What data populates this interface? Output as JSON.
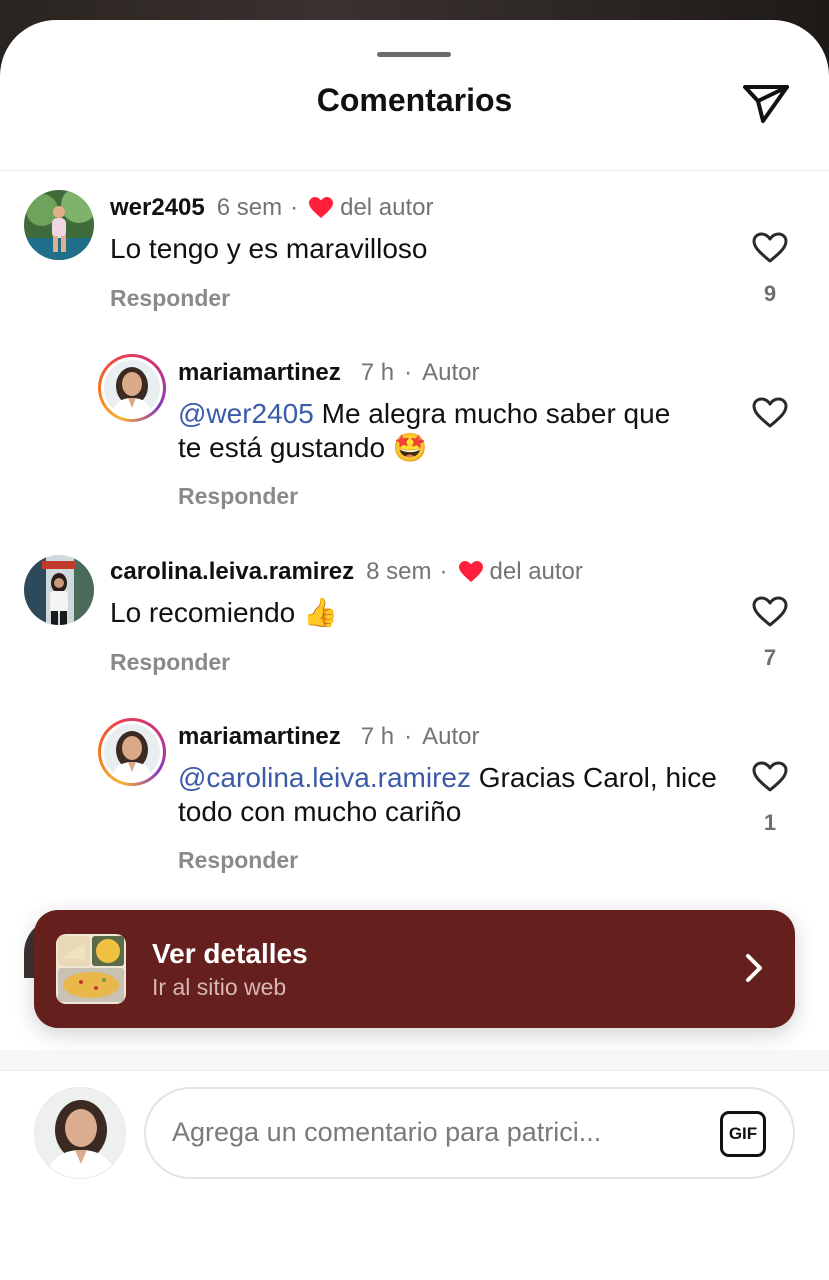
{
  "header": {
    "title": "Comentarios",
    "share_icon": "paper-plane-icon"
  },
  "comments": [
    {
      "user": "wer2405",
      "time": "6 sem",
      "liked_by_author": "del autor",
      "text": "Lo tengo y es maravilloso",
      "reply": "Responder",
      "likes": "9"
    },
    {
      "user": "mariamartinez",
      "time": "7 h",
      "badge": "Autor",
      "mention": "@wer2405",
      "text": " Me alegra mucho saber que te está gustando",
      "emoji": "🤩",
      "reply": "Responder",
      "likes": ""
    },
    {
      "user": "carolina.leiva.ramirez",
      "time": "8 sem",
      "liked_by_author": "del autor",
      "text": "Lo recomiendo",
      "emoji": "👍",
      "reply": "Responder",
      "likes": "7"
    },
    {
      "user": "mariamartinez",
      "time": "7 h",
      "badge": "Autor",
      "mention": "@carolina.leiva.ramirez",
      "text": " Gracias Carol, hice todo con mucho cariño",
      "reply": "Responder",
      "likes": "1"
    }
  ],
  "banner": {
    "title": "Ver detalles",
    "subtitle": "Ir al sitio web",
    "background": "#65201e"
  },
  "composer": {
    "placeholder": "Agrega un comentario para patrici...",
    "gif_label": "GIF"
  },
  "colors": {
    "heart": "#ff1f3d",
    "mention": "#3b5aa8"
  }
}
